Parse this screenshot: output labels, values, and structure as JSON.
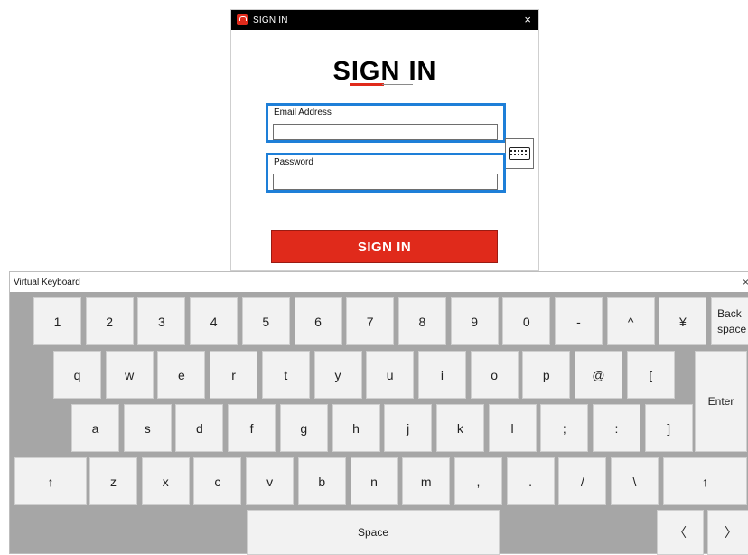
{
  "dialog": {
    "title": "SIGN IN",
    "heading": "SIGN IN",
    "email_label": "Email Address",
    "email_value": "",
    "password_label": "Password",
    "password_value": "",
    "submit_label": "SIGN IN",
    "close_glyph": "×",
    "colors": {
      "accent": "#e02a1b",
      "focus": "#1e7fd8"
    }
  },
  "keyboard": {
    "title": "Virtual Keyboard",
    "close_glyph": "×",
    "row1": [
      "1",
      "2",
      "3",
      "4",
      "5",
      "6",
      "7",
      "8",
      "9",
      "0",
      "-",
      "^",
      "¥"
    ],
    "backspace_line1": "Back",
    "backspace_line2": "space",
    "row2": [
      "q",
      "w",
      "e",
      "r",
      "t",
      "y",
      "u",
      "i",
      "o",
      "p",
      "@",
      "["
    ],
    "enter": "Enter",
    "row3": [
      "a",
      "s",
      "d",
      "f",
      "g",
      "h",
      "j",
      "k",
      "l",
      ";",
      ":",
      "]"
    ],
    "shift_left": "↑",
    "row4": [
      "z",
      "x",
      "c",
      "v",
      "b",
      "n",
      "m",
      ",",
      ".",
      "/",
      "\\"
    ],
    "shift_right": "↑",
    "space": "Space",
    "arrow_left": "〈",
    "arrow_right": "〉"
  }
}
